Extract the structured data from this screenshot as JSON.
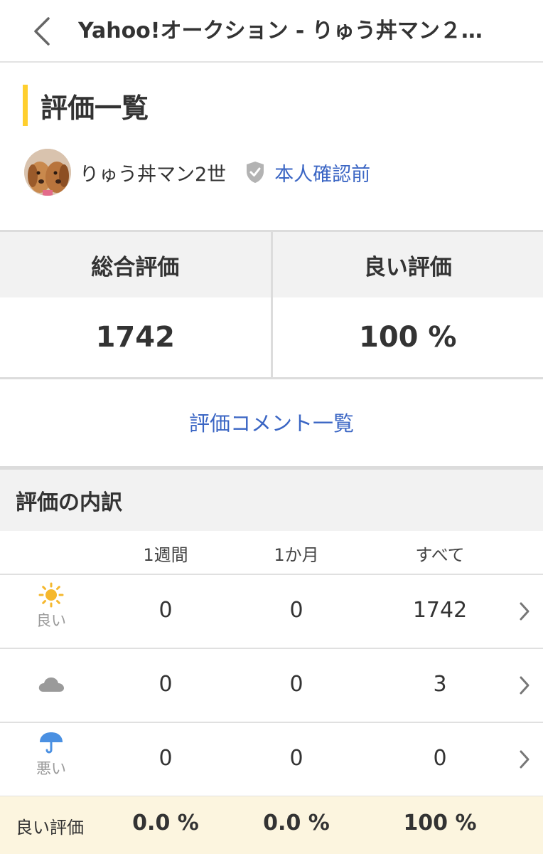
{
  "header": {
    "title": "Yahoo!オークション - りゅう丼マン２…"
  },
  "page": {
    "title": "評価一覧"
  },
  "user": {
    "name": "りゅう丼マン2世",
    "verification_label": "本人確認前"
  },
  "summary": {
    "total_label": "総合評価",
    "total_value": "1742",
    "good_label": "良い評価",
    "good_value": "100 %"
  },
  "comments_link": "評価コメント一覧",
  "breakdown": {
    "title": "評価の内訳",
    "columns": [
      "1週間",
      "1か月",
      "すべて"
    ],
    "rows": [
      {
        "icon": "sun-icon",
        "label": "良い",
        "values": [
          "0",
          "0",
          "1742"
        ]
      },
      {
        "icon": "cloud-icon",
        "label": "",
        "values": [
          "0",
          "0",
          "3"
        ]
      },
      {
        "icon": "umbrella-icon",
        "label": "悪い",
        "values": [
          "0",
          "0",
          "0"
        ]
      }
    ],
    "footer": {
      "label": "良い評価",
      "values": [
        "0.0 %",
        "0.0 %",
        "100 %"
      ]
    }
  },
  "colors": {
    "accent_yellow": "#ffcf2e",
    "link_blue": "#3b66c4",
    "sun": "#f5b82e",
    "cloud": "#9a9a9a",
    "umbrella": "#4a90e2",
    "footer_bg": "#fcf5df"
  }
}
